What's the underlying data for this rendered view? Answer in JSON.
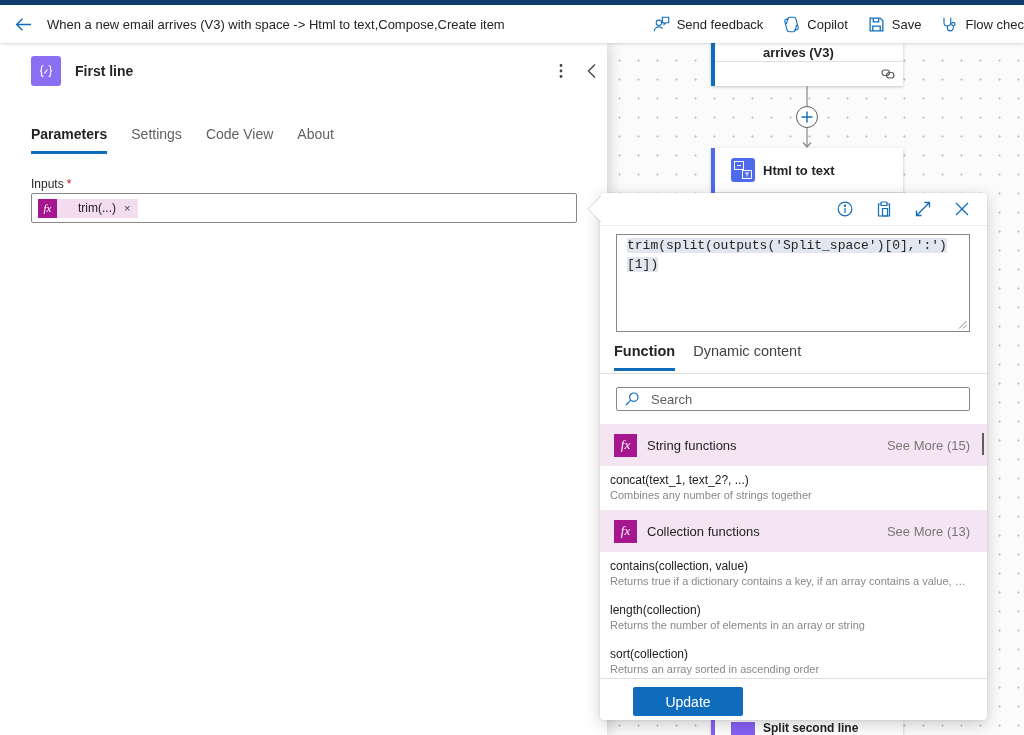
{
  "header": {
    "title": "When a new email arrives (V3) with space -> Html to text,Compose,Create item",
    "actions": [
      {
        "kind": "feedback",
        "label": "Send feedback"
      },
      {
        "kind": "copilot",
        "label": "Copilot"
      },
      {
        "kind": "save",
        "label": "Save"
      },
      {
        "kind": "checker",
        "label": "Flow chec"
      }
    ]
  },
  "panel": {
    "title": "First line",
    "tabs": [
      {
        "label": "Parameters",
        "selected": true
      },
      {
        "label": "Settings",
        "selected": false
      },
      {
        "label": "Code View",
        "selected": false
      },
      {
        "label": "About",
        "selected": false
      }
    ],
    "inputs": {
      "label": "Inputs",
      "required_mark": "*",
      "token": {
        "icon_text": "fx",
        "label": "trim(...)",
        "remove": "×"
      }
    }
  },
  "canvas": {
    "nodes": [
      {
        "kind": "trigger",
        "title": "arrives (V3)"
      },
      {
        "kind": "html_to_text",
        "title": "Html to text"
      },
      {
        "kind": "compose",
        "title": "Split second line"
      }
    ]
  },
  "expression_editor": {
    "expression": "trim(split(outputs('Split_space')[0],':')[1])",
    "tabs": [
      {
        "label": "Function",
        "selected": true
      },
      {
        "label": "Dynamic content",
        "selected": false
      }
    ],
    "search": {
      "placeholder": "Search"
    },
    "groups": [
      {
        "icon_text": "fx",
        "title": "String functions",
        "see_more": "See More (15)",
        "functions": [
          {
            "signature": "concat(text_1, text_2?, ...)",
            "description": "Combines any number of strings together"
          }
        ]
      },
      {
        "icon_text": "fx",
        "title": "Collection functions",
        "see_more": "See More (13)",
        "functions": [
          {
            "signature": "contains(collection, value)",
            "description": "Returns true if a dictionary contains a key, if an array contains a value, …"
          },
          {
            "signature": "length(collection)",
            "description": "Returns the number of elements in an array or string"
          },
          {
            "signature": "sort(collection)",
            "description": "Returns an array sorted in ascending order"
          }
        ]
      }
    ],
    "button": "Update"
  }
}
